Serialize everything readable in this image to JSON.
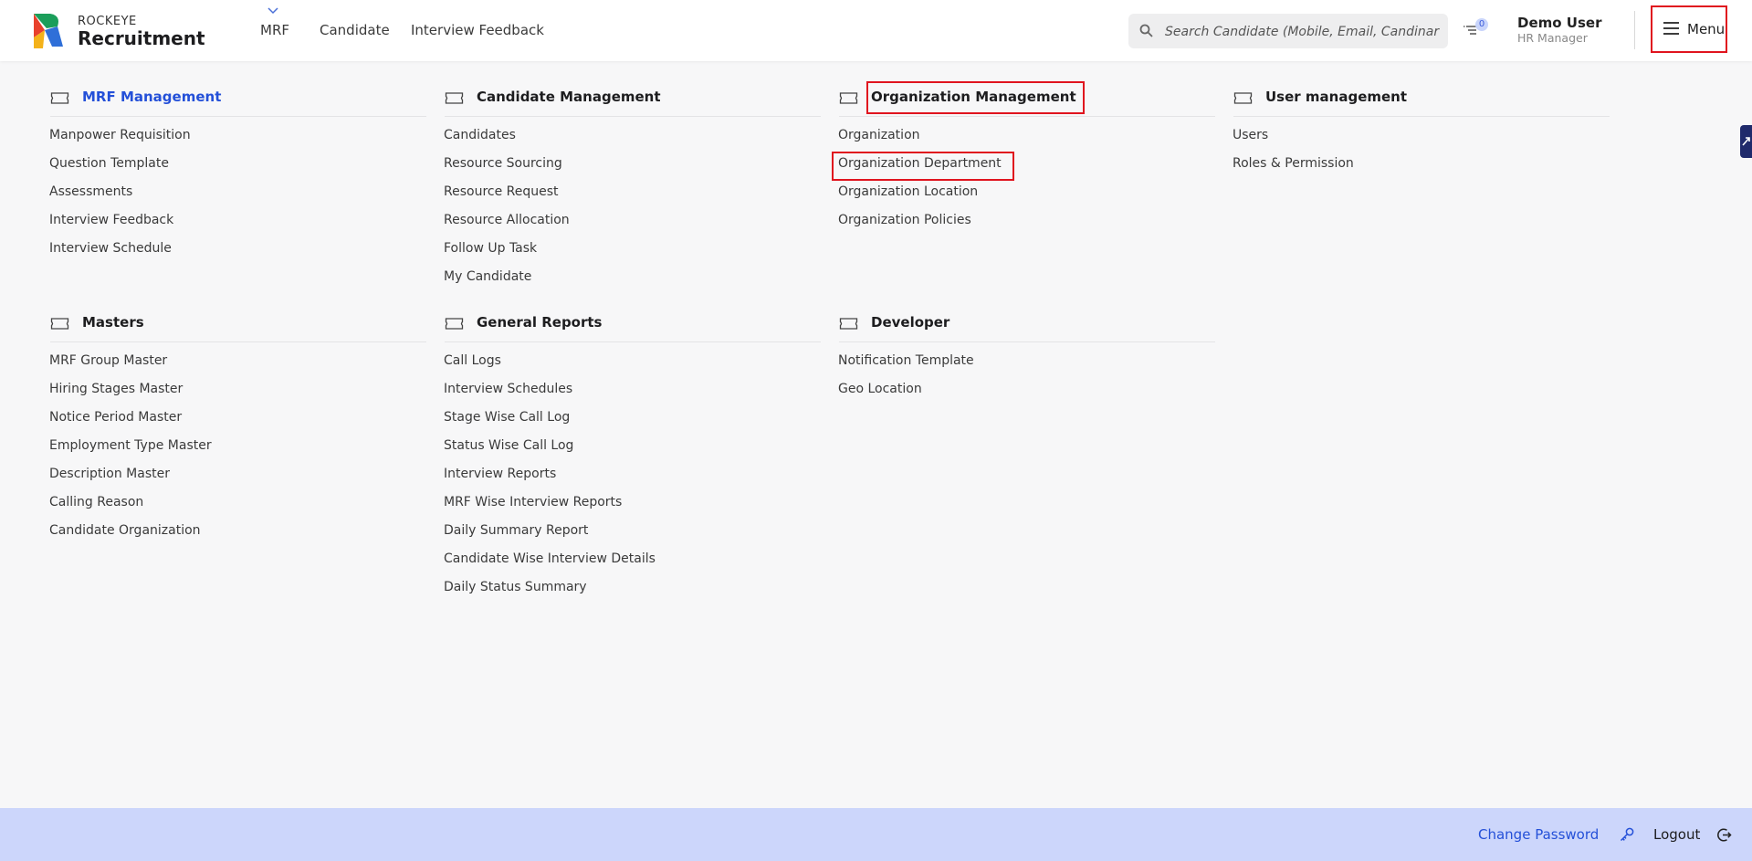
{
  "header": {
    "brand_top": "ROCKEYE",
    "brand_main": "Recruitment",
    "nav": [
      {
        "label": "MRF"
      },
      {
        "label": "Candidate"
      },
      {
        "label": "Interview Feedback"
      }
    ],
    "search": {
      "placeholder": "Search Candidate (Mobile, Email, Candinar"
    },
    "notification_count": "0",
    "user": {
      "name": "Demo User",
      "role": "HR Manager"
    },
    "menu_label": "Menu"
  },
  "menu": {
    "mrf_management": {
      "title": "MRF Management",
      "items": [
        "Manpower Requisition",
        "Question Template",
        "Assessments",
        "Interview Feedback",
        "Interview Schedule"
      ]
    },
    "candidate_management": {
      "title": "Candidate Management",
      "items": [
        "Candidates",
        "Resource Sourcing",
        "Resource Request",
        "Resource Allocation",
        "Follow Up Task",
        "My Candidate"
      ]
    },
    "organization_management": {
      "title": "Organization Management",
      "items": [
        "Organization",
        "Organization Department",
        "Organization Location",
        "Organization Policies"
      ]
    },
    "user_management": {
      "title": "User management",
      "items": [
        "Users",
        "Roles & Permission"
      ]
    },
    "masters": {
      "title": "Masters",
      "items": [
        "MRF Group Master",
        "Hiring Stages Master",
        "Notice Period Master",
        "Employment Type Master",
        "Description Master",
        "Calling Reason",
        "Candidate Organization"
      ]
    },
    "general_reports": {
      "title": "General Reports",
      "items": [
        "Call Logs",
        "Interview Schedules",
        "Stage Wise Call Log",
        "Status Wise Call Log",
        "Interview Reports",
        "MRF Wise Interview Reports",
        "Daily Summary Report",
        "Candidate Wise Interview Details",
        "Daily Status Summary"
      ]
    },
    "developer": {
      "title": "Developer",
      "items": [
        "Notification Template",
        "Geo Location"
      ]
    }
  },
  "footer": {
    "change_password": "Change Password",
    "logout": "Logout"
  },
  "colors": {
    "accent": "#2450d8",
    "highlight": "#e0141e",
    "footer_bg": "#ccd6fb"
  }
}
